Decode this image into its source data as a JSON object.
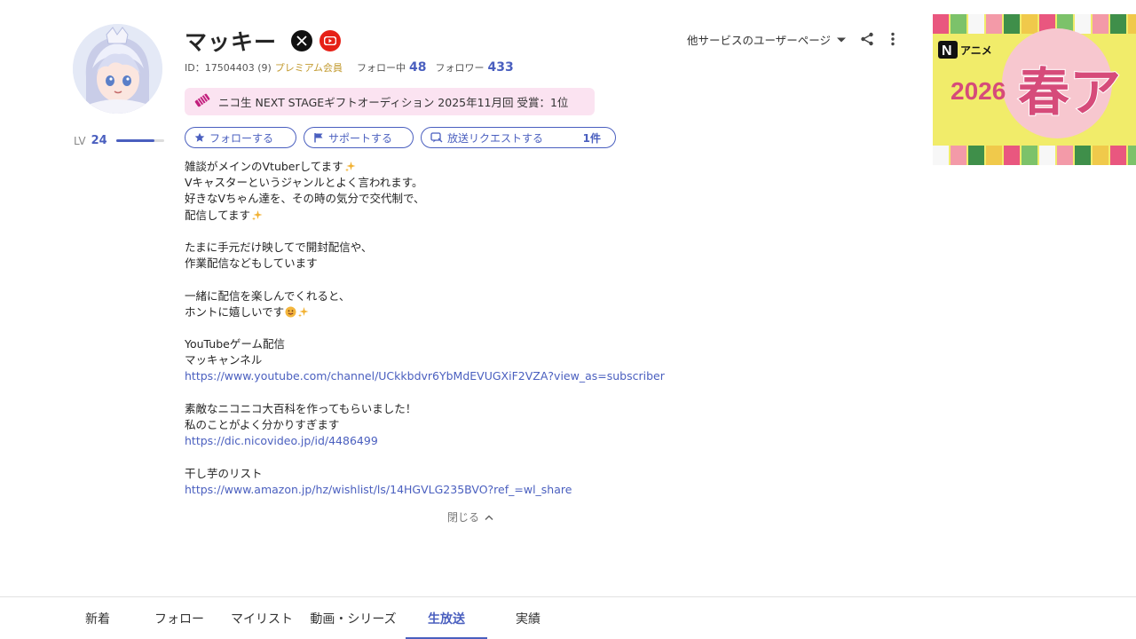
{
  "profile": {
    "name": "マッキー",
    "id_text": "ID：17504403 (9)",
    "premium_label": "プレミアム会員",
    "following_label": "フォロー中",
    "following_count": "48",
    "followers_label": "フォロワー",
    "followers_count": "433",
    "level_label": "LV",
    "level_value": "24",
    "level_progress": 0.8
  },
  "award": {
    "text": "ニコ生 NEXT STAGEギフトオーディション 2025年11月回 受賞：1位"
  },
  "actions": {
    "follow_label": "フォローする",
    "support_label": "サポートする",
    "request_label": "放送リクエストする",
    "request_count": "1件"
  },
  "description": {
    "lines": [
      "雑談がメインのVtuberしてます",
      "Vキャスターというジャンルとよく言われます。",
      "好きなVちゃん達を、その時の気分で交代制で、",
      "配信してます",
      "",
      "たまに手元だけ映してで開封配信や、",
      "作業配信などもしています",
      "",
      "一緒に配信を楽しんでくれると、",
      "ホントに嬉しいです",
      "",
      "YouTubeゲーム配信",
      "マッキャンネル",
      "https://www.youtube.com/channel/UCkkbdvr6YbMdEVUGXiF2VZA?view_as=subscriber",
      "",
      "素敵なニコニコ大百科を作ってもらいました！",
      "私のことがよく分かりすぎます",
      "https://dic.nicovideo.jp/id/4486499",
      "",
      "干し芋のリスト",
      "https://www.amazon.jp/hz/wishlist/ls/14HGVLG235BVO?ref_=wl_share"
    ],
    "close_label": "閉じる"
  },
  "header_controls": {
    "other_services_label": "他サービスのユーザーページ"
  },
  "banner": {
    "brand": "アニメ",
    "year": "2026",
    "headline": "春ア"
  },
  "tabs": [
    {
      "label": "新着"
    },
    {
      "label": "フォロー"
    },
    {
      "label": "マイリスト"
    },
    {
      "label": "動画・シリーズ"
    },
    {
      "label": "生放送"
    },
    {
      "label": "実績"
    }
  ],
  "colors": {
    "accent": "#4a5fbf",
    "premium": "#c29a2f",
    "award_bg": "#fbe3f1",
    "youtube": "#e62117",
    "banner_bg": "#f1ec6a"
  }
}
